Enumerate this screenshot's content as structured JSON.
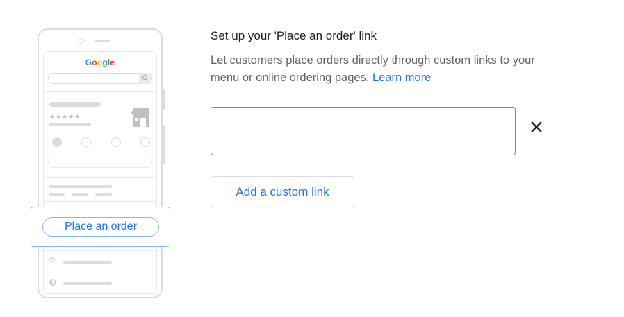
{
  "illustration": {
    "logo_text": "Google",
    "stars": "★★★★★",
    "callout_button_label": "Place an order",
    "icons": [
      "camera-icon",
      "search-icon",
      "store-icon",
      "phone-icon",
      "globe-icon"
    ]
  },
  "panel": {
    "title": "Set up your 'Place an order' link",
    "description": "Let customers place orders directly through custom links to your menu or online ordering pages.",
    "learn_more": "Learn more",
    "link_input": {
      "value": "",
      "placeholder": ""
    },
    "remove_icon": "close-icon",
    "add_button_label": "Add a custom link"
  },
  "colors": {
    "accent": "#1a73e8",
    "callout_border": "#8ab4f8",
    "text_primary": "#202124",
    "text_secondary": "#5f6368"
  }
}
